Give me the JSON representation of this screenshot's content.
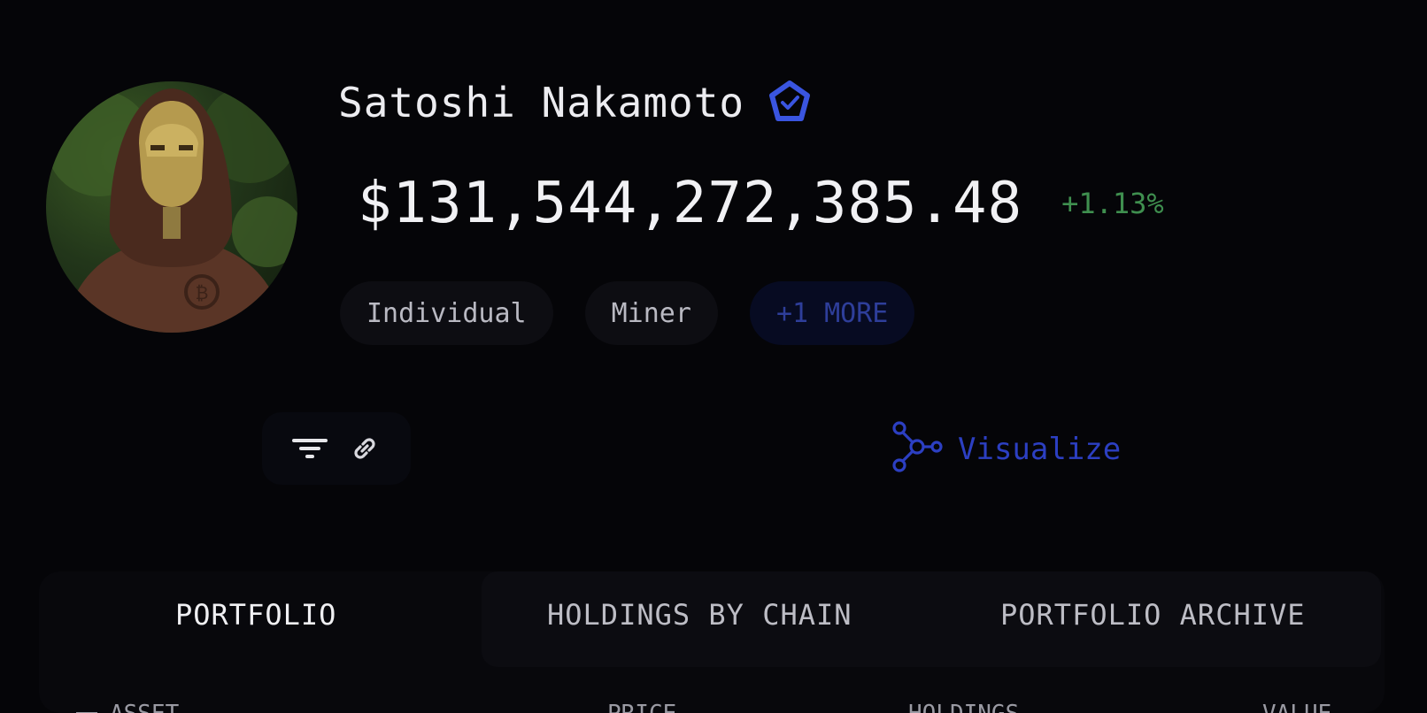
{
  "profile": {
    "name": "Satoshi Nakamoto",
    "verified": true,
    "balance": "$131,544,272,385.48",
    "change": "+1.13%",
    "tags": [
      "Individual",
      "Miner"
    ],
    "more_tag": "+1 MORE"
  },
  "actions": {
    "visualize_label": "Visualize"
  },
  "tabs": [
    {
      "label": "PORTFOLIO",
      "active": true
    },
    {
      "label": "HOLDINGS BY CHAIN",
      "active": false
    },
    {
      "label": "PORTFOLIO ARCHIVE",
      "active": false
    }
  ],
  "table": {
    "headers": [
      "ASSET",
      "PRICE",
      "HOLDINGS",
      "VALUE"
    ]
  },
  "colors": {
    "background": "#050508",
    "accent_blue": "#2c3fc2",
    "positive_green": "#3f8f4f"
  },
  "icons": [
    "verified-badge-icon",
    "filter-icon",
    "link-icon",
    "network-graph-icon"
  ]
}
